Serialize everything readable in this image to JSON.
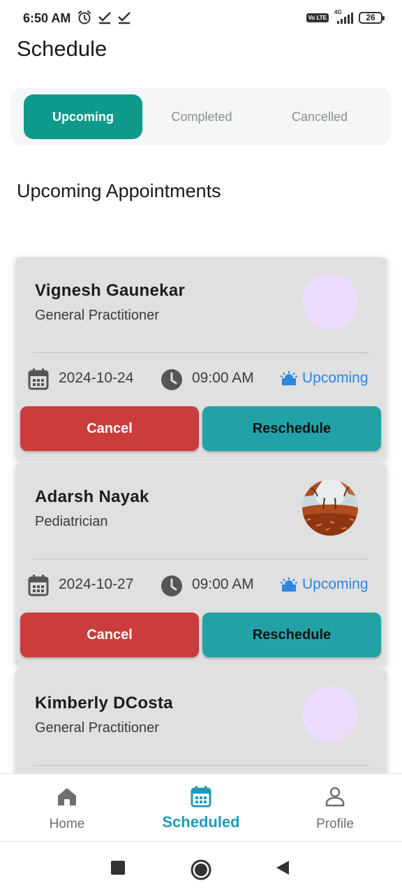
{
  "status_bar": {
    "time": "6:50 AM",
    "left_icons": [
      "alarm-icon",
      "check-icon",
      "check-icon"
    ],
    "volte_label": "Vo LTE",
    "network_label": "4G",
    "battery": "26"
  },
  "header": {
    "title": "Schedule"
  },
  "tabs": [
    {
      "label": "Upcoming",
      "active": true
    },
    {
      "label": "Completed",
      "active": false
    },
    {
      "label": "Cancelled",
      "active": false
    }
  ],
  "section": {
    "title": "Upcoming Appointments"
  },
  "appointments": [
    {
      "doctor": "Vignesh Gaunekar",
      "specialty": "General Practitioner",
      "date": "2024-10-24",
      "time": "09:00 AM",
      "status": "Upcoming",
      "cancel_label": "Cancel",
      "reschedule_label": "Reschedule",
      "avatar": "placeholder"
    },
    {
      "doctor": "Adarsh Nayak",
      "specialty": "Pediatrician",
      "date": "2024-10-27",
      "time": "09:00 AM",
      "status": "Upcoming",
      "cancel_label": "Cancel",
      "reschedule_label": "Reschedule",
      "avatar": "photo"
    },
    {
      "doctor": "Kimberly DCosta",
      "specialty": "General Practitioner",
      "date": "",
      "time": "",
      "status": "",
      "cancel_label": "",
      "reschedule_label": "",
      "avatar": "placeholder"
    }
  ],
  "bottom_nav": [
    {
      "label": "Home",
      "icon": "home-icon",
      "active": false
    },
    {
      "label": "Scheduled",
      "icon": "calendar-icon",
      "active": true
    },
    {
      "label": "Profile",
      "icon": "profile-icon",
      "active": false
    }
  ],
  "system_nav": [
    "recents-icon",
    "home-circle-icon",
    "back-icon"
  ],
  "colors": {
    "accent": "#0d9a8a",
    "cancel": "#cb3c3c",
    "reschedule": "#22a2a6",
    "status_blue": "#2a86de",
    "nav_active": "#1f9bb8",
    "avatar_placeholder": "#ecdcfd"
  }
}
